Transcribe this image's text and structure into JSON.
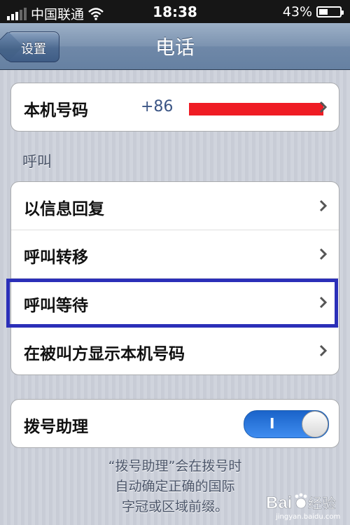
{
  "status_bar": {
    "carrier": "中国联通",
    "time": "18:38",
    "battery": "43%",
    "battery_level": 0.43
  },
  "nav": {
    "back_label": "设置",
    "title": "电话"
  },
  "my_number": {
    "label": "本机号码",
    "value": "+86"
  },
  "section_header": "呼叫",
  "calls": [
    {
      "label": "以信息回复"
    },
    {
      "label": "呼叫转移"
    },
    {
      "label": "呼叫等待"
    },
    {
      "label": "在被叫方显示本机号码"
    }
  ],
  "dial_assist": {
    "label": "拨号助理",
    "toggle_text": "I",
    "on": true
  },
  "footer_lines": [
    "“拨号助理”会在拨号时",
    "自动确定正确的国际",
    "字冠或区域前缀。"
  ],
  "watermark": {
    "brand": "Bai",
    "brand_cn": "经验",
    "url": "jingyan.baidu.com"
  },
  "colors": {
    "nav_bar": "#7c93b0",
    "toggle_on": "#3f8df0",
    "highlight": "#2b2fb8",
    "redaction": "#ef1c24",
    "detail_text": "#3b5585"
  }
}
